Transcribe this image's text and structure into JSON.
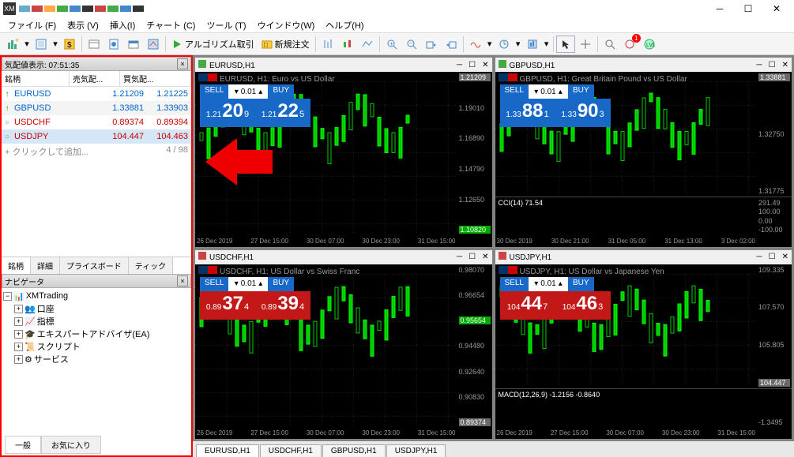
{
  "menu": {
    "file": "ファイル (F)",
    "view": "表示 (V)",
    "insert": "挿入(I)",
    "chart": "チャート (C)",
    "tool": "ツール (T)",
    "window": "ウインドウ(W)",
    "help": "ヘルプ(H)"
  },
  "toolbar": {
    "algo": "アルゴリズム取引",
    "neworder": "新規注文"
  },
  "market_watch": {
    "title": "気配値表示: 07:51:35",
    "cols": {
      "sym": "銘柄",
      "bid": "売気配...",
      "ask": "買気配..."
    },
    "rows": [
      {
        "ico": "↑",
        "sym": "EURUSD",
        "bid": "1.21209",
        "ask": "1.21225",
        "color": "#0066cc"
      },
      {
        "ico": "↑",
        "sym": "GBPUSD",
        "bid": "1.33881",
        "ask": "1.33903",
        "color": "#0066cc"
      },
      {
        "ico": "○",
        "sym": "USDCHF",
        "bid": "0.89374",
        "ask": "0.89394",
        "color": "#cc0000"
      },
      {
        "ico": "○",
        "sym": "USDJPY",
        "bid": "104.447",
        "ask": "104.463",
        "color": "#cc0000"
      }
    ],
    "add": "クリックして追加...",
    "count": "4 / 98",
    "tabs": {
      "sym": "銘柄",
      "detail": "詳細",
      "price": "プライスボード",
      "tick": "ティック"
    }
  },
  "navigator": {
    "title": "ナビゲータ",
    "root": "XMTrading",
    "items": [
      "口座",
      "指標",
      "エキスパートアドバイザ(EA)",
      "スクリプト",
      "サービス"
    ]
  },
  "bottom_tabs": {
    "general": "一般",
    "fav": "お気に入り"
  },
  "charts": [
    {
      "title": "EURUSD,H1",
      "label": "EURUSD, H1:  Euro vs US Dollar",
      "lot": "0.01",
      "sell": {
        "s": "1.21",
        "b": "20",
        "p": "9"
      },
      "buy": {
        "s": "1.21",
        "b": "22",
        "p": "5"
      },
      "prices": [
        "1.21209",
        "1.19010",
        "1.16890",
        "1.14790",
        "1.12650",
        "1.10820"
      ],
      "pbox_top": "1.21209",
      "pbox_bot": "1.10820",
      "times": [
        "26 Dec 2019",
        "27 Dec 15:00",
        "30 Dec 07:00",
        "30 Dec 23:00",
        "31 Dec 15:00"
      ],
      "red": false
    },
    {
      "title": "GBPUSD,H1",
      "label": "GBPUSD, H1:  Great Britain Pound vs US Dollar",
      "lot": "0.01",
      "sell": {
        "s": "1.33",
        "b": "88",
        "p": "1"
      },
      "buy": {
        "s": "1.33",
        "b": "90",
        "p": "3"
      },
      "prices": [
        "1.33881",
        "1.32750",
        "1.31775"
      ],
      "pbox_top": "1.33881",
      "ind": "CCI(14) 71.54",
      "ind_vals": [
        "291.49",
        "100.00",
        "0.00",
        "-100.00"
      ],
      "times": [
        "30 Dec 2019",
        "30 Dec 21:00",
        "31 Dec 05:00",
        "31 Dec 13:00",
        "3 Dec 02:00"
      ],
      "red": false
    },
    {
      "title": "USDCHF,H1",
      "label": "USDCHF, H1:  US Dollar vs Swiss Franc",
      "lot": "0.01",
      "sell": {
        "s": "0.89",
        "b": "37",
        "p": "4"
      },
      "buy": {
        "s": "0.89",
        "b": "39",
        "p": "4"
      },
      "prices": [
        "0.98070",
        "0.96654",
        "0.95654",
        "0.94480",
        "0.92640",
        "0.90830",
        "0.89374"
      ],
      "pbox_mid": "0.95654",
      "pbox_bot": "0.89374",
      "times": [
        "26 Dec 2019",
        "27 Dec 15:00",
        "30 Dec 07:00",
        "30 Dec 23:00",
        "31 Dec 15:00"
      ],
      "red": true
    },
    {
      "title": "USDJPY,H1",
      "label": "USDJPY, H1:  US Dollar vs Japanese Yen",
      "lot": "0.01",
      "sell": {
        "s": "104",
        "b": "44",
        "p": "7"
      },
      "buy": {
        "s": "104",
        "b": "46",
        "p": "3"
      },
      "prices": [
        "109.335",
        "107.570",
        "105.805",
        "104.447"
      ],
      "pbox_bot": "104.447",
      "ind": "MACD(12,26,9) -1.2156 -0.8640",
      "ind_vals": [
        "",
        "-1.3495"
      ],
      "times": [
        "26 Dec 2019",
        "27 Dec 15:00",
        "30 Dec 07:00",
        "30 Dec 23:00",
        "31 Dec 15:00"
      ],
      "red": true
    }
  ],
  "chart_tabs": [
    "EURUSD,H1",
    "USDCHF,H1",
    "GBPUSD,H1",
    "USDJPY,H1"
  ]
}
